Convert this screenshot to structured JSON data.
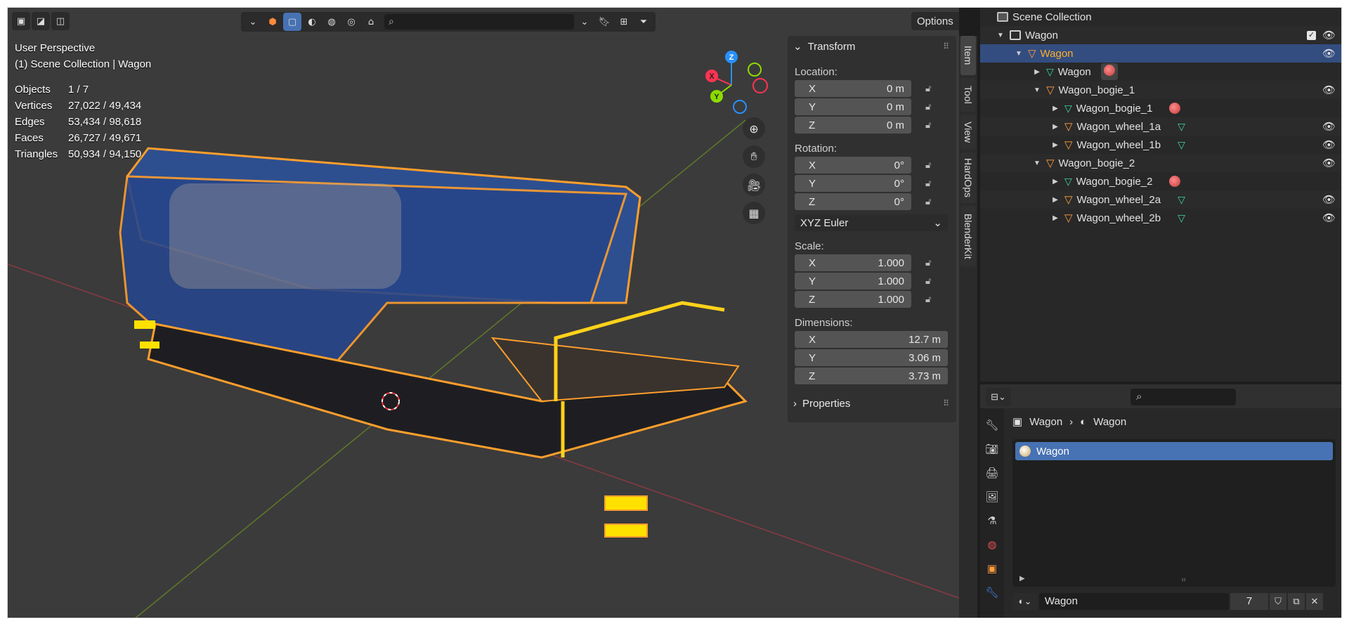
{
  "viewport": {
    "mode_label": "User Perspective",
    "context_label": "(1) Scene Collection | Wagon",
    "options_label": "Options",
    "stats": [
      {
        "key": "Objects",
        "value": "1 / 7"
      },
      {
        "key": "Vertices",
        "value": "27,022 / 49,434"
      },
      {
        "key": "Edges",
        "value": "53,434 / 98,618"
      },
      {
        "key": "Faces",
        "value": "26,727 / 49,671"
      },
      {
        "key": "Triangles",
        "value": "50,934 / 94,150"
      }
    ],
    "gizmo": {
      "x": "X",
      "y": "Y",
      "z": "Z"
    },
    "colors": {
      "background": "#3b3b3b",
      "selection": "#ff9e2c",
      "wagon_body": "#2d4f8f",
      "x_axis": "#ff3352",
      "y_axis": "#8bdc00",
      "z_axis": "#2890ff"
    }
  },
  "npanel": {
    "transform_title": "Transform",
    "location_label": "Location:",
    "location": [
      {
        "axis": "X",
        "value": "0 m"
      },
      {
        "axis": "Y",
        "value": "0 m"
      },
      {
        "axis": "Z",
        "value": "0 m"
      }
    ],
    "rotation_label": "Rotation:",
    "rotation": [
      {
        "axis": "X",
        "value": "0°"
      },
      {
        "axis": "Y",
        "value": "0°"
      },
      {
        "axis": "Z",
        "value": "0°"
      }
    ],
    "rotation_mode": "XYZ Euler",
    "scale_label": "Scale:",
    "scale": [
      {
        "axis": "X",
        "value": "1.000"
      },
      {
        "axis": "Y",
        "value": "1.000"
      },
      {
        "axis": "Z",
        "value": "1.000"
      }
    ],
    "dimensions_label": "Dimensions:",
    "dimensions": [
      {
        "axis": "X",
        "value": "12.7 m"
      },
      {
        "axis": "Y",
        "value": "3.06 m"
      },
      {
        "axis": "Z",
        "value": "3.73 m"
      }
    ],
    "properties_title": "Properties",
    "tabs": [
      "Item",
      "Tool",
      "View",
      "HardOps",
      "BlenderKit"
    ]
  },
  "outliner": {
    "root": "Scene Collection",
    "rows": [
      {
        "label": "Wagon",
        "type": "collection"
      },
      {
        "label": "Wagon",
        "type": "object"
      },
      {
        "label": "Wagon",
        "type": "mesh"
      },
      {
        "label": "Wagon_bogie_1",
        "type": "object"
      },
      {
        "label": "Wagon_bogie_1",
        "type": "mesh"
      },
      {
        "label": "Wagon_wheel_1a",
        "type": "object"
      },
      {
        "label": "Wagon_wheel_1b",
        "type": "object"
      },
      {
        "label": "Wagon_bogie_2",
        "type": "object"
      },
      {
        "label": "Wagon_bogie_2",
        "type": "mesh"
      },
      {
        "label": "Wagon_wheel_2a",
        "type": "object"
      },
      {
        "label": "Wagon_wheel_2b",
        "type": "object"
      }
    ]
  },
  "properties": {
    "breadcrumb_object": "Wagon",
    "breadcrumb_material": "Wagon",
    "material_slot": "Wagon",
    "datablock_name": "Wagon",
    "datablock_users": "7"
  }
}
